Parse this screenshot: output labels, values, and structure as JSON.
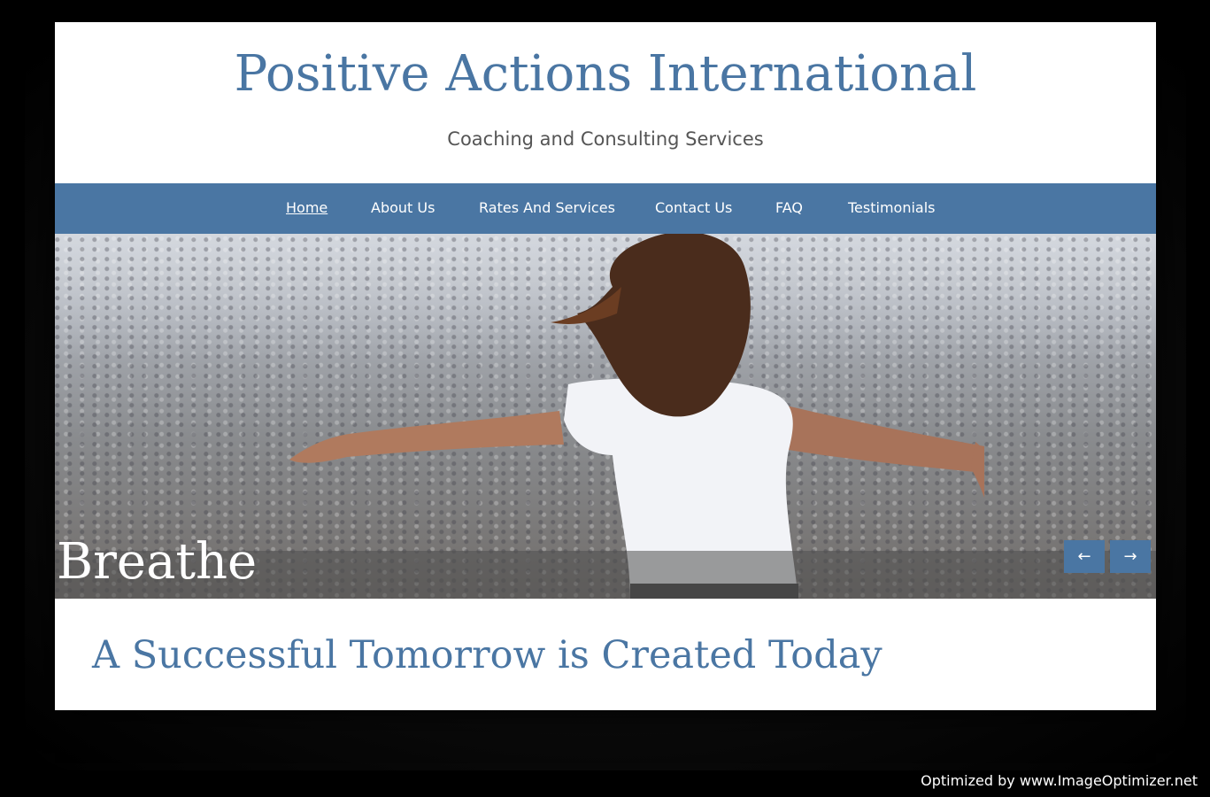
{
  "site": {
    "title": "Positive Actions International",
    "tagline": "Coaching and Consulting Services"
  },
  "nav": {
    "items": [
      {
        "label": "Home",
        "active": true
      },
      {
        "label": "About Us",
        "active": false
      },
      {
        "label": "Rates And Services",
        "active": false
      },
      {
        "label": "Contact Us",
        "active": false
      },
      {
        "label": "FAQ",
        "active": false
      },
      {
        "label": "Testimonials",
        "active": false
      }
    ]
  },
  "slider": {
    "caption": "Breathe",
    "prev_label": "←",
    "next_label": "→"
  },
  "main": {
    "headline": "A Successful Tomorrow is Created Today"
  },
  "watermark": "Optimized by www.ImageOptimizer.net",
  "colors": {
    "brand_blue": "#4a76a3",
    "tagline_gray": "#555555"
  }
}
